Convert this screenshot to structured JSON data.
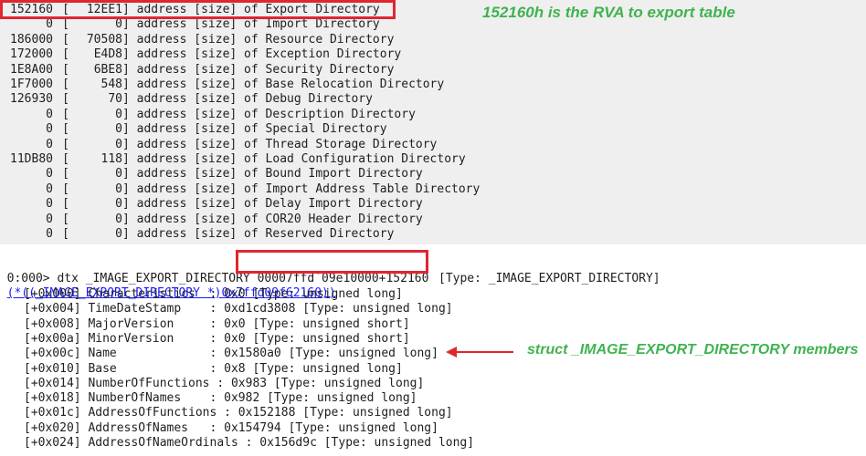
{
  "directories": [
    {
      "rva": "152160",
      "size": "12EE1",
      "text": "address [size] of Export Directory"
    },
    {
      "rva": "0",
      "size": "0",
      "text": "address [size] of Import Directory"
    },
    {
      "rva": "186000",
      "size": "70508",
      "text": "address [size] of Resource Directory"
    },
    {
      "rva": "172000",
      "size": "E4D8",
      "text": "address [size] of Exception Directory"
    },
    {
      "rva": "1E8A00",
      "size": "6BE8",
      "text": "address [size] of Security Directory"
    },
    {
      "rva": "1F7000",
      "size": "548",
      "text": "address [size] of Base Relocation Directory"
    },
    {
      "rva": "126930",
      "size": "70",
      "text": "address [size] of Debug Directory"
    },
    {
      "rva": "0",
      "size": "0",
      "text": "address [size] of Description Directory"
    },
    {
      "rva": "0",
      "size": "0",
      "text": "address [size] of Special Directory"
    },
    {
      "rva": "0",
      "size": "0",
      "text": "address [size] of Thread Storage Directory"
    },
    {
      "rva": "11DB80",
      "size": "118",
      "text": "address [size] of Load Configuration Directory"
    },
    {
      "rva": "0",
      "size": "0",
      "text": "address [size] of Bound Import Directory"
    },
    {
      "rva": "0",
      "size": "0",
      "text": "address [size] of Import Address Table Directory"
    },
    {
      "rva": "0",
      "size": "0",
      "text": "address [size] of Delay Import Directory"
    },
    {
      "rva": "0",
      "size": "0",
      "text": "address [size] of COR20 Header Directory"
    },
    {
      "rva": "0",
      "size": "0",
      "text": "address [size] of Reserved Directory"
    }
  ],
  "annotations": {
    "rva_note": "152160h is the RVA to export table",
    "struct_note": "struct _IMAGE_EXPORT_DIRECTORY members"
  },
  "command": {
    "prompt": "0:000> dtx _IMAGE_EXPORT_DIRECTORY ",
    "argument": "00007ffd`09e10000+152160"
  },
  "result": {
    "link_text": "(*((_IMAGE_EXPORT_DIRECTORY *)0x7ffd09f62160))",
    "type_text": "[Type: _IMAGE_EXPORT_DIRECTORY]"
  },
  "members": [
    "[+0x000] Characteristics  : 0x0 [Type: unsigned long]",
    "[+0x004] TimeDateStamp    : 0xd1cd3808 [Type: unsigned long]",
    "[+0x008] MajorVersion     : 0x0 [Type: unsigned short]",
    "[+0x00a] MinorVersion     : 0x0 [Type: unsigned short]",
    "[+0x00c] Name             : 0x1580a0 [Type: unsigned long]",
    "[+0x010] Base             : 0x8 [Type: unsigned long]",
    "[+0x014] NumberOfFunctions : 0x983 [Type: unsigned long]",
    "[+0x018] NumberOfNames    : 0x982 [Type: unsigned long]",
    "[+0x01c] AddressOfFunctions : 0x152188 [Type: unsigned long]",
    "[+0x020] AddressOfNames   : 0x154794 [Type: unsigned long]",
    "[+0x024] AddressOfNameOrdinals : 0x156d9c [Type: unsigned long]"
  ],
  "colors": {
    "highlight": "#e0262f",
    "annotation": "#3fb34f",
    "link": "#1a1aff"
  }
}
